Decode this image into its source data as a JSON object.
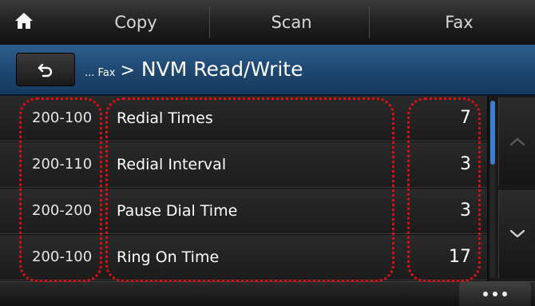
{
  "tabs": [
    {
      "label": "Copy"
    },
    {
      "label": "Scan"
    },
    {
      "label": "Fax"
    }
  ],
  "icons": {
    "home": "home-icon",
    "back": "back-arrow-icon",
    "scroll_up": "chevron-up-icon",
    "scroll_down": "chevron-down-icon",
    "more": "ellipsis-icon"
  },
  "header": {
    "breadcrumb_parent": "... Fax",
    "breadcrumb_separator": ">",
    "title": "NVM Read/Write"
  },
  "rows": [
    {
      "code": "200-100",
      "name": "Redial Times",
      "value": "7"
    },
    {
      "code": "200-110",
      "name": "Redial Interval",
      "value": "3"
    },
    {
      "code": "200-200",
      "name": "Pause Dial Time",
      "value": "3"
    },
    {
      "code": "200-100",
      "name": "Ring On Time",
      "value": "17"
    }
  ],
  "colors": {
    "title_bar": "#1d4670",
    "scroll_thumb": "#3b7fd1",
    "annotation": "#e01010"
  }
}
